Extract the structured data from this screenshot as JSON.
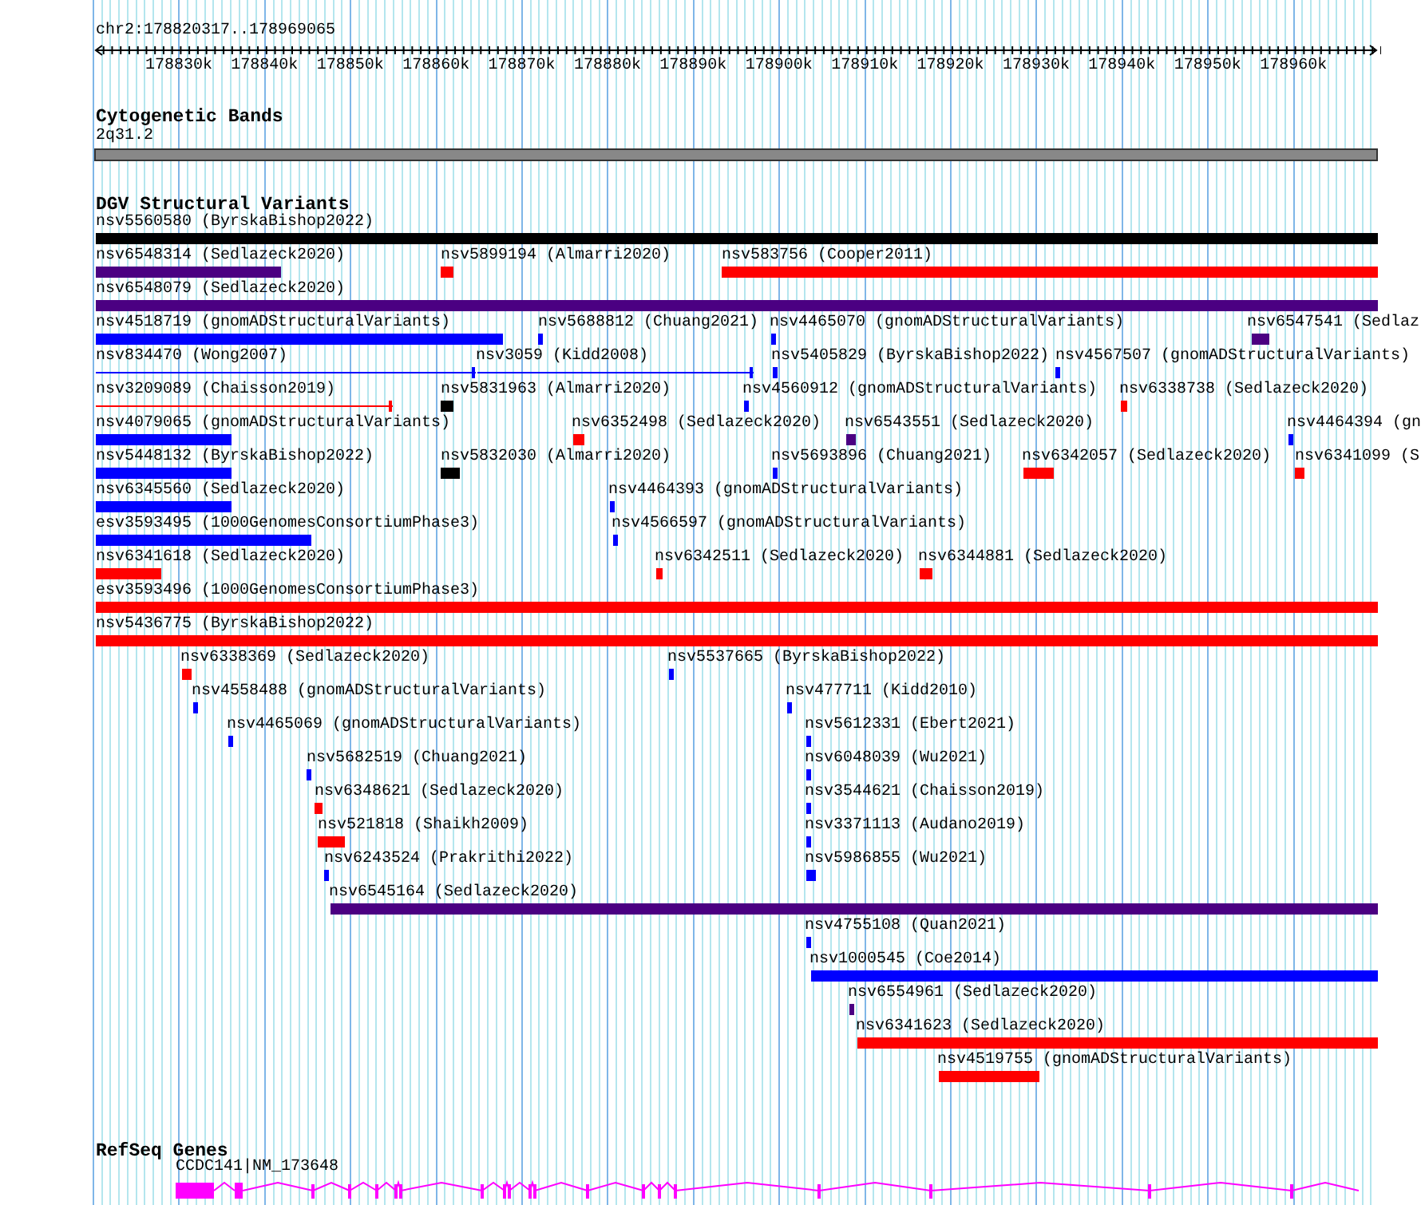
{
  "ruler": {
    "location": "chr2:178820317..178969065",
    "ticks": [
      "178830k",
      "178840k",
      "178850k",
      "178860k",
      "178870k",
      "178880k",
      "178890k",
      "178900k",
      "178910k",
      "178920k",
      "178930k",
      "178940k",
      "178950k",
      "178960k"
    ]
  },
  "cytogenetic_bands": {
    "title": "Cytogenetic Bands",
    "bands": [
      {
        "label": "2q31.2"
      }
    ]
  },
  "dgv_structural_variants": {
    "title": "DGV Structural Variants",
    "features": [
      {
        "label": "nsv5560580 (ByrskaBishop2022)",
        "color": "#000000",
        "kind": "bar"
      },
      {
        "label": "nsv6548314 (Sedlazeck2020)",
        "color": "#4b0082",
        "kind": "bar"
      },
      {
        "label": "nsv5899194 (Almarri2020)",
        "color": "#ff0000",
        "kind": "bar"
      },
      {
        "label": "nsv583756 (Cooper2011)",
        "color": "#ff0000",
        "kind": "bar"
      },
      {
        "label": "nsv6548079 (Sedlazeck2020)",
        "color": "#4b0082",
        "kind": "bar"
      },
      {
        "label": "nsv4518719 (gnomADStructuralVariants)",
        "color": "#0000ff",
        "kind": "bar"
      },
      {
        "label": "nsv5688812 (Chuang2021)",
        "color": "#0000ff",
        "kind": "bar"
      },
      {
        "label": "nsv4465070 (gnomADStructuralVariants)",
        "color": "#0000ff",
        "kind": "bar"
      },
      {
        "label": "nsv6547541 (Sedlaz",
        "color": "#4b0082",
        "kind": "bar"
      },
      {
        "label": "nsv834470 (Wong2007)",
        "color": "#0000ff",
        "kind": "span"
      },
      {
        "label": "nsv3059 (Kidd2008)",
        "color": "#0000ff",
        "kind": "span"
      },
      {
        "label": "nsv5405829 (ByrskaBishop2022)",
        "color": "#0000ff",
        "kind": "bar"
      },
      {
        "label": "nsv4567507 (gnomADStructuralVariants)",
        "color": "#0000ff",
        "kind": "bar"
      },
      {
        "label": "nsv3209089 (Chaisson2019)",
        "color": "#ff0000",
        "kind": "span"
      },
      {
        "label": "nsv5831963 (Almarri2020)",
        "color": "#000000",
        "kind": "bar"
      },
      {
        "label": "nsv4560912 (gnomADStructuralVariants)",
        "color": "#0000ff",
        "kind": "bar"
      },
      {
        "label": "nsv6338738 (Sedlazeck2020)",
        "color": "#ff0000",
        "kind": "bar"
      },
      {
        "label": "nsv4079065 (gnomADStructuralVariants)",
        "color": "#0000ff",
        "kind": "bar"
      },
      {
        "label": "nsv6352498 (Sedlazeck2020)",
        "color": "#ff0000",
        "kind": "bar"
      },
      {
        "label": "nsv6543551 (Sedlazeck2020)",
        "color": "#4b0082",
        "kind": "bar"
      },
      {
        "label": "nsv4464394 (gn",
        "color": "#0000ff",
        "kind": "bar"
      },
      {
        "label": "nsv5448132 (ByrskaBishop2022)",
        "color": "#0000ff",
        "kind": "bar"
      },
      {
        "label": "nsv5832030 (Almarri2020)",
        "color": "#000000",
        "kind": "bar"
      },
      {
        "label": "nsv5693896 (Chuang2021)",
        "color": "#0000ff",
        "kind": "bar"
      },
      {
        "label": "nsv6342057 (Sedlazeck2020)",
        "color": "#ff0000",
        "kind": "bar"
      },
      {
        "label": "nsv6341099 (S",
        "color": "#ff0000",
        "kind": "bar"
      },
      {
        "label": "nsv6345560 (Sedlazeck2020)",
        "color": "#0000ff",
        "kind": "bar"
      },
      {
        "label": "nsv4464393 (gnomADStructuralVariants)",
        "color": "#0000ff",
        "kind": "bar"
      },
      {
        "label": "esv3593495 (1000GenomesConsortiumPhase3)",
        "color": "#0000ff",
        "kind": "bar"
      },
      {
        "label": "nsv4566597 (gnomADStructuralVariants)",
        "color": "#0000ff",
        "kind": "bar"
      },
      {
        "label": "nsv6341618 (Sedlazeck2020)",
        "color": "#ff0000",
        "kind": "bar"
      },
      {
        "label": "nsv6342511 (Sedlazeck2020)",
        "color": "#ff0000",
        "kind": "bar"
      },
      {
        "label": "nsv6344881 (Sedlazeck2020)",
        "color": "#ff0000",
        "kind": "bar"
      },
      {
        "label": "esv3593496 (1000GenomesConsortiumPhase3)",
        "color": "#ff0000",
        "kind": "bar"
      },
      {
        "label": "nsv5436775 (ByrskaBishop2022)",
        "color": "#ff0000",
        "kind": "bar"
      },
      {
        "label": "nsv6338369 (Sedlazeck2020)",
        "color": "#ff0000",
        "kind": "bar"
      },
      {
        "label": "nsv5537665 (ByrskaBishop2022)",
        "color": "#0000ff",
        "kind": "bar"
      },
      {
        "label": "nsv4558488 (gnomADStructuralVariants)",
        "color": "#0000ff",
        "kind": "bar"
      },
      {
        "label": "nsv477711 (Kidd2010)",
        "color": "#0000ff",
        "kind": "bar"
      },
      {
        "label": "nsv4465069 (gnomADStructuralVariants)",
        "color": "#0000ff",
        "kind": "bar"
      },
      {
        "label": "nsv5612331 (Ebert2021)",
        "color": "#0000ff",
        "kind": "bar"
      },
      {
        "label": "nsv5682519 (Chuang2021)",
        "color": "#0000ff",
        "kind": "bar"
      },
      {
        "label": "nsv6048039 (Wu2021)",
        "color": "#0000ff",
        "kind": "bar"
      },
      {
        "label": "nsv6348621 (Sedlazeck2020)",
        "color": "#ff0000",
        "kind": "bar"
      },
      {
        "label": "nsv3544621 (Chaisson2019)",
        "color": "#0000ff",
        "kind": "bar"
      },
      {
        "label": "nsv521818 (Shaikh2009)",
        "color": "#ff0000",
        "kind": "bar"
      },
      {
        "label": "nsv3371113 (Audano2019)",
        "color": "#0000ff",
        "kind": "bar"
      },
      {
        "label": "nsv6243524 (Prakrithi2022)",
        "color": "#0000ff",
        "kind": "bar"
      },
      {
        "label": "nsv5986855 (Wu2021)",
        "color": "#0000ff",
        "kind": "bar"
      },
      {
        "label": "nsv6545164 (Sedlazeck2020)",
        "color": "#4b0082",
        "kind": "bar"
      },
      {
        "label": "nsv4755108 (Quan2021)",
        "color": "#0000ff",
        "kind": "bar"
      },
      {
        "label": "nsv1000545 (Coe2014)",
        "color": "#0000ff",
        "kind": "bar"
      },
      {
        "label": "nsv6554961 (Sedlazeck2020)",
        "color": "#4b0082",
        "kind": "bar"
      },
      {
        "label": "nsv6341623 (Sedlazeck2020)",
        "color": "#ff0000",
        "kind": "bar"
      },
      {
        "label": "nsv4519755 (gnomADStructuralVariants)",
        "color": "#ff0000",
        "kind": "bar"
      }
    ]
  },
  "refseq_genes": {
    "title": "RefSeq Genes",
    "genes": [
      {
        "label": "CCDC141|NM_173648"
      }
    ]
  }
}
